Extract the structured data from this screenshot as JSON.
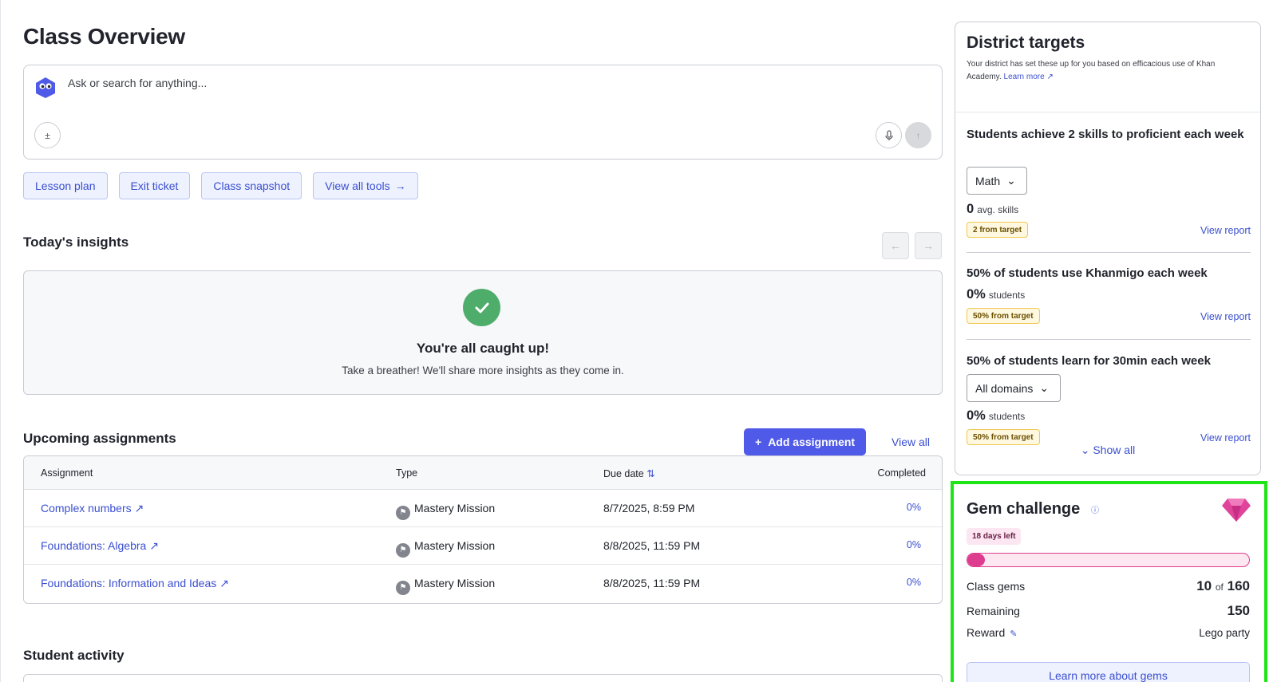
{
  "page": {
    "title": "Class Overview"
  },
  "ask": {
    "placeholder": "Ask or search for anything...",
    "calc_icon": "calculator-icon",
    "mic_icon": "microphone-icon",
    "send_icon": "arrow-up-icon"
  },
  "tools": [
    {
      "label": "Lesson plan"
    },
    {
      "label": "Exit ticket"
    },
    {
      "label": "Class snapshot"
    },
    {
      "label": "View all tools",
      "icon": "arrow-right-icon"
    }
  ],
  "insights": {
    "title": "Today's insights",
    "empty_title": "You're all caught up!",
    "empty_subtitle": "Take a breather! We'll share more insights as they come in."
  },
  "assignments": {
    "title": "Upcoming assignments",
    "add_label": "Add assignment",
    "view_all_label": "View all",
    "columns": {
      "assignment": "Assignment",
      "type": "Type",
      "due": "Due date",
      "completed": "Completed"
    },
    "rows": [
      {
        "name": "Complex numbers",
        "type": "Mastery Mission",
        "due": "8/7/2025, 8:59 PM",
        "completed": "0%"
      },
      {
        "name": "Foundations: Algebra",
        "type": "Mastery Mission",
        "due": "8/8/2025, 11:59 PM",
        "completed": "0%"
      },
      {
        "name": "Foundations: Information and Ideas",
        "type": "Mastery Mission",
        "due": "8/8/2025, 11:59 PM",
        "completed": "0%"
      }
    ]
  },
  "activity": {
    "title": "Student activity"
  },
  "district": {
    "title": "District targets",
    "description": "Your district has set these up for you based on efficacious use of Khan Academy.",
    "learn_more": "Learn more",
    "show_all": "Show all",
    "targets": [
      {
        "title": "Students achieve 2 skills to proficient each week",
        "dropdown": "Math",
        "value": "0",
        "unit": "avg. skills",
        "badge": "2 from target",
        "link": "View report"
      },
      {
        "title": "50% of students use Khanmigo each week",
        "value": "0%",
        "unit": "students",
        "badge": "50% from target",
        "link": "View report"
      },
      {
        "title": "50% of students learn for 30min each week",
        "dropdown": "All domains",
        "value": "0%",
        "unit": "students",
        "badge": "50% from target",
        "link": "View report"
      }
    ]
  },
  "gem": {
    "title": "Gem challenge",
    "days_left": "18 days left",
    "progress_fraction": 0.0625,
    "class_gems_label": "Class gems",
    "class_gems_value": "10",
    "class_gems_of": "of",
    "class_gems_total": "160",
    "remaining_label": "Remaining",
    "remaining_value": "150",
    "reward_label": "Reward",
    "reward_value": "Lego party",
    "learn_more": "Learn more about gems",
    "colors": {
      "accent": "#de3c8f",
      "highlight_border": "#1ee516"
    }
  }
}
